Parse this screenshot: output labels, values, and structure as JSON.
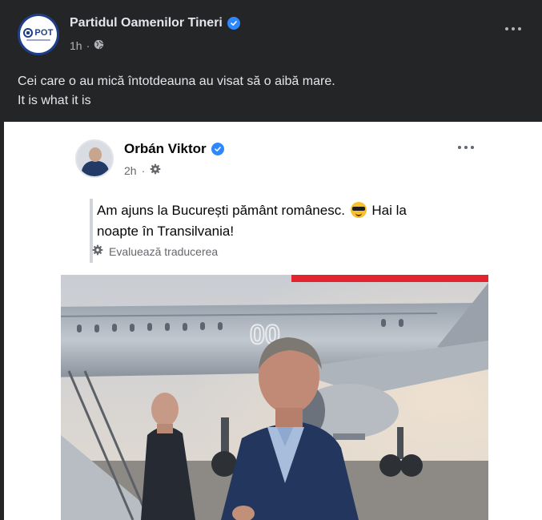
{
  "post": {
    "page_name": "Partidul Oamenilor Tineri",
    "time": "1h",
    "separator": "·",
    "avatar_text": "POT",
    "caption_line1": "Cei care o au mică întotdeauna au visat să o aibă mare.",
    "caption_line2": "It is what it is"
  },
  "shared": {
    "author": "Orbán Viktor",
    "time": "2h",
    "separator": "·",
    "text_line1_a": "Am ajuns la București pământ românesc.",
    "text_line1_b": "Hai la",
    "text_line2": "noapte în Transilvania!",
    "translate_label": "Evaluează traducerea"
  },
  "icons": {
    "verified": "verified-badge-icon",
    "globe": "globe-icon",
    "more": "more-options-icon",
    "audience": "audience-gear-icon",
    "translate": "translate-gear-icon",
    "emoji": "sunglasses-emoji-icon"
  },
  "colors": {
    "background": "#242526",
    "verified": "#2d88ff",
    "brand": "#1f3e8a",
    "photo_bar": "#e2242f"
  }
}
